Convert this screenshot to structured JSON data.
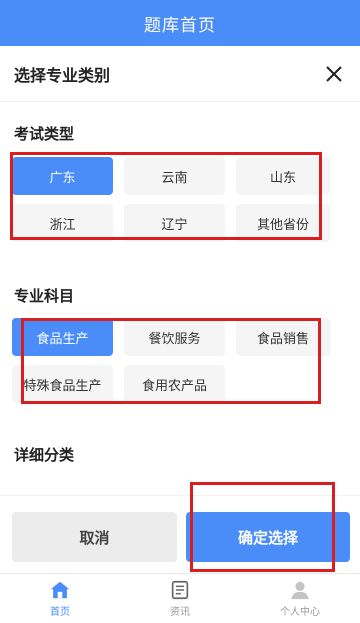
{
  "appbar": {
    "title": "题库首页"
  },
  "sheet": {
    "title": "选择专业类别",
    "close_icon": "close-icon"
  },
  "sections": {
    "exam_type": {
      "title": "考试类型",
      "items": [
        "广东",
        "云南",
        "山东",
        "浙江",
        "辽宁",
        "其他省份"
      ],
      "selected": "广东"
    },
    "subject": {
      "title": "专业科目",
      "items": [
        "食品生产",
        "餐饮服务",
        "食品销售",
        "特殊食品生产",
        "食用农产品"
      ],
      "selected": "食品生产"
    },
    "detail": {
      "title": "详细分类"
    }
  },
  "actions": {
    "cancel": "取消",
    "confirm": "确定选择"
  },
  "tabs": [
    {
      "label": "首页",
      "icon": "home-icon",
      "active": true
    },
    {
      "label": "资讯",
      "icon": "news-icon",
      "active": false
    },
    {
      "label": "个人中心",
      "icon": "user-icon",
      "active": false
    }
  ],
  "colors": {
    "primary": "#4b8df8",
    "annotation": "#d81e1e"
  }
}
